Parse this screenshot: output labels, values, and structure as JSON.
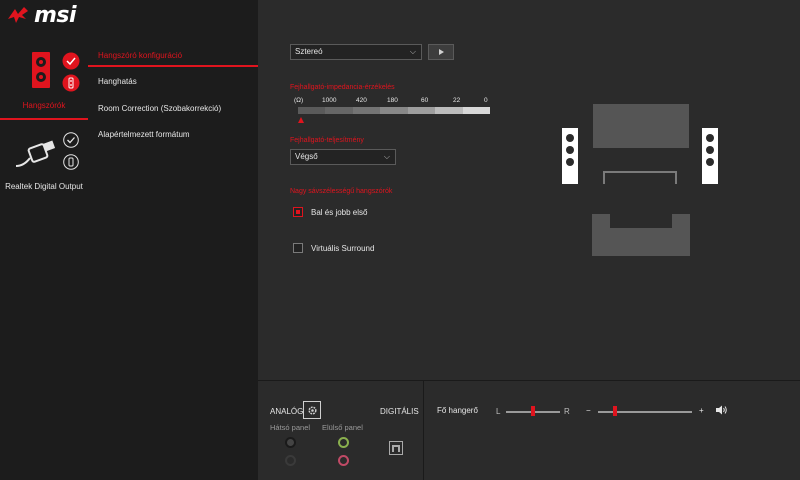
{
  "app": {
    "brand": "msi"
  },
  "titlebar": {
    "icons": [
      "info-icon",
      "settings-icon",
      "minimize-icon",
      "close-icon"
    ]
  },
  "devices": [
    {
      "label": "Hangszórók",
      "active": true
    },
    {
      "label": "Realtek Digital Output",
      "active": false
    }
  ],
  "menu": {
    "items": [
      {
        "label": "Hangszóró konfiguráció",
        "active": true
      },
      {
        "label": "Hanghatás",
        "active": false
      },
      {
        "label": "Room Correction (Szobakorrekció)",
        "active": false
      },
      {
        "label": "Alapértelmezett formátum",
        "active": false
      }
    ]
  },
  "config": {
    "speaker_mode": "Sztereó",
    "impedance": {
      "title": "Fejhallgató-impedancia-érzékelés",
      "unit": "(Ω)",
      "scale": [
        "1000",
        "420",
        "180",
        "60",
        "22",
        "0"
      ],
      "bar_colors": [
        "#5a5a5a",
        "#666666",
        "#747474",
        "#888888",
        "#9e9e9e",
        "#bcbcbc",
        "#d8d8d8"
      ],
      "marker_segment": 0
    },
    "headphone_power": {
      "title": "Fejhallgató-teljesítmény",
      "value": "Végső"
    },
    "fullrange": {
      "title": "Nagy sávszélességű hangszórók",
      "front_lr": {
        "label": "Bal és jobb első",
        "checked": true
      }
    },
    "virtual_surround": {
      "label": "Virtuális Surround",
      "checked": false
    }
  },
  "bottom": {
    "analog": "ANALÓG",
    "digital": "DIGITÁLIS",
    "rear_panel": "Hátsó panel",
    "front_panel": "Elülső panel",
    "jacks": {
      "rear_top": "#1a1a1a",
      "rear_bottom": "#3a3a3a",
      "front_top": "#8ab04e",
      "front_bottom": "#c04a66"
    },
    "master_volume": {
      "label": "Fő hangerő",
      "balance_left": "L",
      "balance_right": "R",
      "minus": "−",
      "plus": "+",
      "balance_position": 0.5,
      "volume_level": 0.18
    }
  },
  "colors": {
    "accent": "#e0141e",
    "panel_dark": "#1c1c1c",
    "panel_main": "#2b2b2b"
  }
}
